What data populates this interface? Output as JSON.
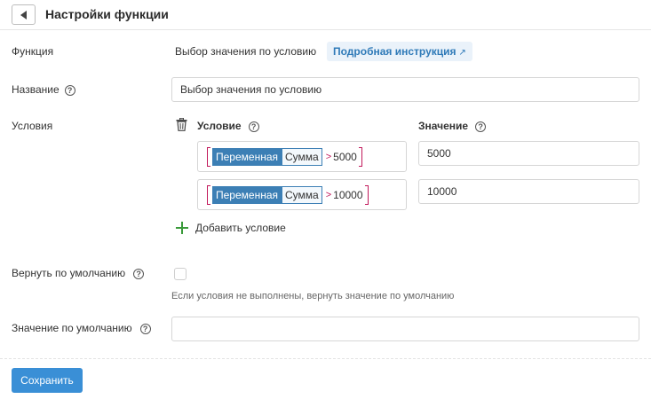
{
  "header": {
    "title": "Настройки функции"
  },
  "function_row": {
    "label": "Функция",
    "value": "Выбор значения по условию",
    "guide_link": "Подробная инструкция",
    "guide_arrow": "↗"
  },
  "name_row": {
    "label": "Название",
    "value": "Выбор значения по условию"
  },
  "conditions": {
    "label": "Условия",
    "col_condition": "Условие",
    "col_value": "Значение",
    "items": [
      {
        "var_label": "Переменная",
        "var_name": "Сумма",
        "operator": ">",
        "operand": "5000",
        "value": "5000"
      },
      {
        "var_label": "Переменная",
        "var_name": "Сумма",
        "operator": ">",
        "operand": "10000",
        "value": "10000"
      }
    ],
    "add_label": "Добавить условие"
  },
  "return_default": {
    "label": "Вернуть по умолчанию",
    "hint": "Если условия не выполнены, вернуть значение по умолчанию",
    "checked": false
  },
  "default_value": {
    "label": "Значение по умолчанию",
    "value": ""
  },
  "help_glyph": "?",
  "footer": {
    "save_label": "Сохранить"
  },
  "colors": {
    "accent": "#3a8fd6",
    "variable": "#3c7fb5",
    "bracket": "#c2185b",
    "add": "#3a9a3a"
  }
}
